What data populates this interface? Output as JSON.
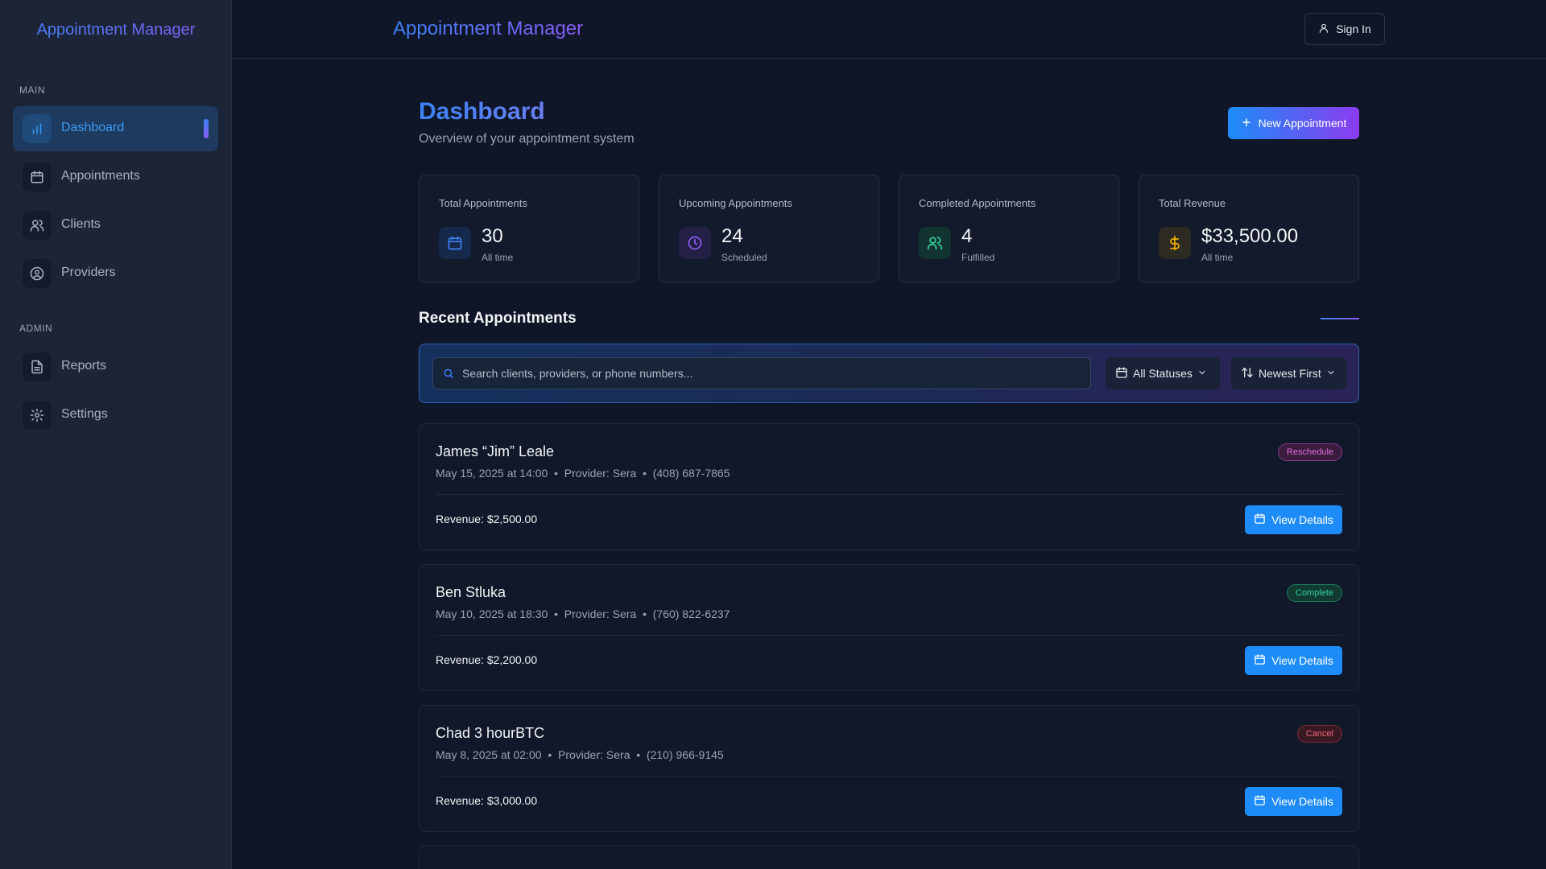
{
  "app": {
    "title": "Appointment Manager"
  },
  "sidebar": {
    "title": "Appointment Manager",
    "sections": [
      {
        "label": "MAIN",
        "items": [
          {
            "label": "Dashboard",
            "icon": "bar-chart-icon",
            "active": true
          },
          {
            "label": "Appointments",
            "icon": "calendar-icon"
          },
          {
            "label": "Clients",
            "icon": "users-icon"
          },
          {
            "label": "Providers",
            "icon": "user-circle-icon"
          }
        ]
      },
      {
        "label": "ADMIN",
        "items": [
          {
            "label": "Reports",
            "icon": "file-text-icon"
          },
          {
            "label": "Settings",
            "icon": "gear-icon"
          }
        ]
      }
    ]
  },
  "topbar": {
    "title": "Appointment Manager",
    "signin_label": "Sign In"
  },
  "page": {
    "title": "Dashboard",
    "subtitle": "Overview of your appointment system",
    "new_button_label": "New Appointment"
  },
  "stats": [
    {
      "label": "Total Appointments",
      "value": "30",
      "sub": "All time",
      "icon": "calendar-icon",
      "color": "#3b82f6"
    },
    {
      "label": "Upcoming Appointments",
      "value": "24",
      "sub": "Scheduled",
      "icon": "clock-icon",
      "color": "#8b5cf6"
    },
    {
      "label": "Completed Appointments",
      "value": "4",
      "sub": "Fulfilled",
      "icon": "users-icon",
      "color": "#34d399"
    },
    {
      "label": "Total Revenue",
      "value": "$33,500.00",
      "sub": "All time",
      "icon": "dollar-icon",
      "color": "#f5b400"
    }
  ],
  "recent": {
    "title": "Recent Appointments",
    "search_placeholder": "Search clients, providers, or phone numbers...",
    "status_filter": "All Statuses",
    "sort": "Newest First",
    "appointments": [
      {
        "name": "James “Jim” Leale",
        "meta": "May 15, 2025 at 14:00  •  Provider: Sera  •  (408) 687-7865",
        "revenue": "Revenue: $2,500.00",
        "status": "Reschedule",
        "status_color": "#e36ad9",
        "button": "View Details"
      },
      {
        "name": "Ben Stluka",
        "meta": "May 10, 2025 at 18:30  •  Provider: Sera  •  (760) 822-6237",
        "revenue": "Revenue: $2,200.00",
        "status": "Complete",
        "status_color": "#34d399",
        "button": "View Details"
      },
      {
        "name": "Chad 3 hourBTC",
        "meta": "May 8, 2025 at 02:00  •  Provider: Sera  •  (210) 966-9145",
        "revenue": "Revenue: $3,000.00",
        "status": "Cancel",
        "status_color": "#f0627a",
        "button": "View Details"
      }
    ]
  }
}
